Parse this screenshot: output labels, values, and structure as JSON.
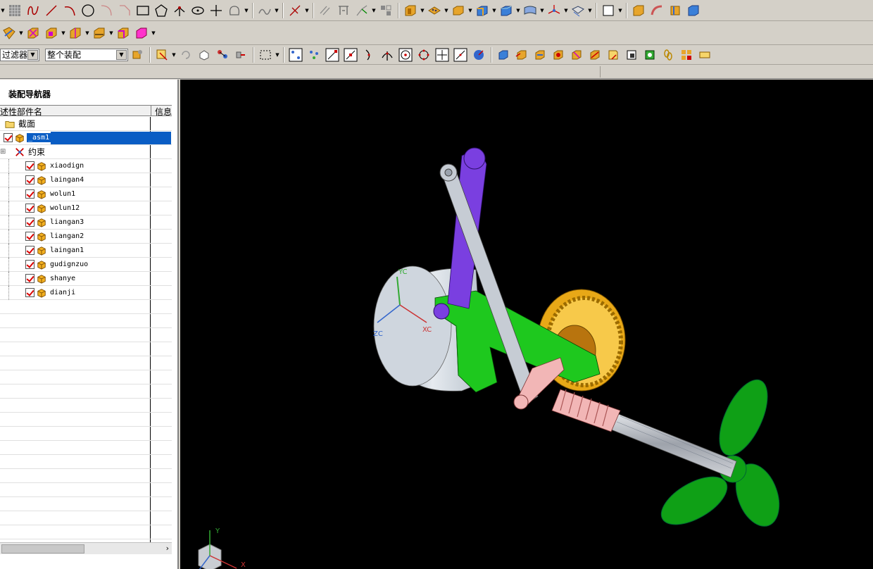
{
  "toolbar3": {
    "filter_label": "过滤器",
    "scope_label": "整个装配"
  },
  "navigator": {
    "title": "装配导航器",
    "col_name": "述性部件名",
    "col_info": "信息",
    "section_row": "截面",
    "root_part": "_asm1",
    "constraints": "约束",
    "parts": [
      "xiaodign",
      "laingan4",
      "wolun1",
      "wolun12",
      "liangan3",
      "liangan2",
      "laingan1",
      "gudignzuo",
      "shanye",
      "dianji"
    ]
  },
  "viewport": {
    "axis_xc": "XC",
    "axis_yc": "YC",
    "axis_zc": "ZC",
    "triad_x": "X",
    "triad_y": "Y"
  },
  "colors": {
    "background": "#000000",
    "motor": "#d8dde3",
    "bracket_green": "#1ec81e",
    "link_purple": "#7a3fe0",
    "gear_gold": "#e8a817",
    "worm_pink": "#f2b6b6",
    "shaft": "#b8bcc4",
    "propeller": "#0fa016",
    "selection": "#0a5dc4"
  }
}
